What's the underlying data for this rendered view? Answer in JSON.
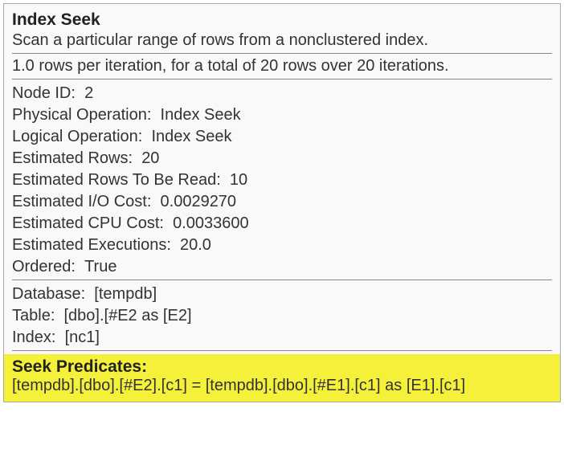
{
  "header": {
    "title": "Index Seek",
    "description": "Scan a particular range of rows from a nonclustered index.",
    "summary": "1.0 rows per iteration, for a total of 20 rows over 20 iterations."
  },
  "properties": {
    "node_id": {
      "label": "Node ID:",
      "value": "2"
    },
    "physical_op": {
      "label": "Physical Operation:",
      "value": "Index Seek"
    },
    "logical_op": {
      "label": "Logical Operation:",
      "value": "Index Seek"
    },
    "est_rows": {
      "label": "Estimated Rows:",
      "value": "20"
    },
    "est_rows_read": {
      "label": "Estimated Rows To Be Read:",
      "value": "10"
    },
    "est_io": {
      "label": "Estimated I/O Cost:",
      "value": "0.0029270"
    },
    "est_cpu": {
      "label": "Estimated CPU Cost:",
      "value": "0.0033600"
    },
    "est_exec": {
      "label": "Estimated Executions:",
      "value": "20.0"
    },
    "ordered": {
      "label": "Ordered:",
      "value": "True"
    }
  },
  "object": {
    "database": {
      "label": "Database:",
      "value": "[tempdb]"
    },
    "table": {
      "label": "Table:",
      "value": "[dbo].[#E2 as [E2]"
    },
    "index": {
      "label": "Index:",
      "value": "[nc1]"
    }
  },
  "seek": {
    "title": "Seek Predicates:",
    "value": "[tempdb].[dbo].[#E2].[c1] = [tempdb].[dbo].[#E1].[c1] as [E1].[c1]"
  }
}
